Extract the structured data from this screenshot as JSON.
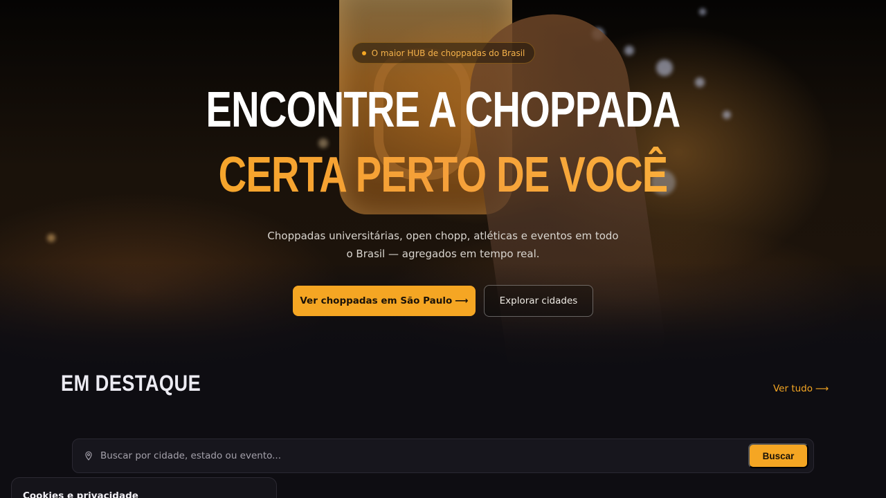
{
  "hero": {
    "badge": "O maior HUB de choppadas do Brasil",
    "headline_line1": "ENCONTRE A CHOPPADA",
    "headline_line2": "CERTA PERTO DE VOCÊ",
    "subtitle": "Choppadas universitárias, open chopp, atléticas e eventos em todo o Brasil — agregados em tempo real.",
    "primary_button": "Ver choppadas em São Paulo",
    "primary_arrow": "⟶",
    "secondary_button": "Explorar cidades"
  },
  "featured": {
    "title": "EM DESTAQUE",
    "see_all": "Ver tudo",
    "see_all_arrow": "⟶"
  },
  "search": {
    "placeholder": "Buscar por cidade, estado ou evento...",
    "button": "Buscar",
    "icon": "map-pin-icon"
  },
  "cookie_banner": {
    "title": "Cookies e privacidade"
  },
  "colors": {
    "accent": "#f5a623",
    "background": "#0e0d12"
  }
}
